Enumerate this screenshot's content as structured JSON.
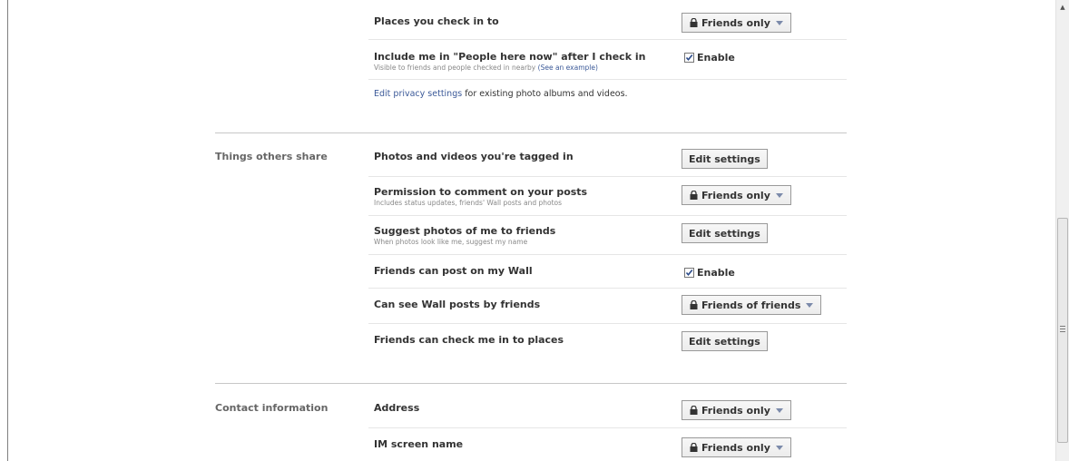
{
  "sections": {
    "things_others_share": "Things others share",
    "contact_information": "Contact information"
  },
  "settings": {
    "places_check_in": {
      "title": "Places you check in to",
      "control": "Friends only"
    },
    "people_here_now": {
      "title": "Include me in \"People here now\" after I check in",
      "sub": "Visible to friends and people checked in nearby",
      "sub_link": "(See an example)",
      "control": "Enable",
      "checked": true
    },
    "edit_privacy_note": {
      "link": "Edit privacy settings",
      "text": " for existing photo albums and videos."
    },
    "photos_tagged": {
      "title": "Photos and videos you're tagged in",
      "control": "Edit settings"
    },
    "permission_comment": {
      "title": "Permission to comment on your posts",
      "sub": "Includes status updates, friends' Wall posts and photos",
      "control": "Friends only"
    },
    "suggest_photos": {
      "title": "Suggest photos of me to friends",
      "sub": "When photos look like me, suggest my name",
      "control": "Edit settings"
    },
    "friends_post_wall": {
      "title": "Friends can post on my Wall",
      "control": "Enable",
      "checked": true
    },
    "see_wall_posts": {
      "title": "Can see Wall posts by friends",
      "control": "Friends of friends"
    },
    "friends_check_in": {
      "title": "Friends can check me in to places",
      "control": "Edit settings"
    },
    "address": {
      "title": "Address",
      "control": "Friends only"
    },
    "im_screen_name": {
      "title": "IM screen name",
      "control": "Friends only"
    }
  },
  "icons": {
    "lock": "lock-icon",
    "dropdown": "chevron-down-icon",
    "checkbox": "checkbox-checked"
  },
  "colors": {
    "link": "#3b5998",
    "caret": "#7b8aaa"
  }
}
